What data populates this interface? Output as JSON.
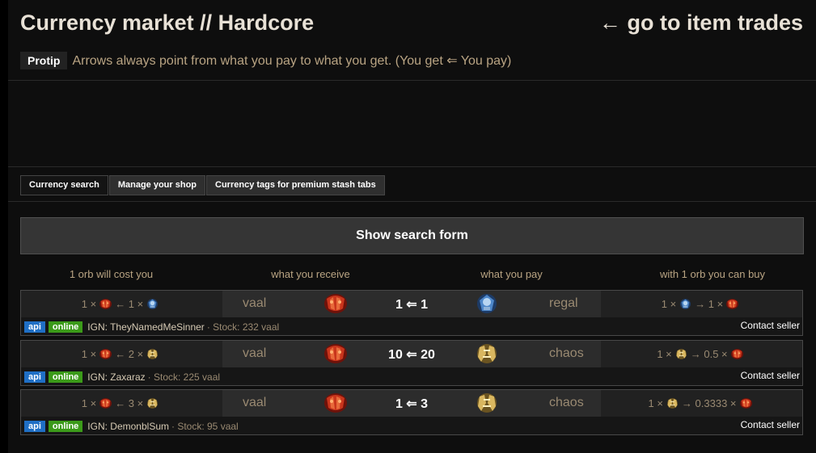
{
  "header": {
    "title": "Currency market // Hardcore",
    "goto_link": "← go to item trades"
  },
  "protip": {
    "label": "Protip",
    "text": "Arrows always point from what you pay to what you get. (You get ⇐ You pay)"
  },
  "tabs": [
    {
      "label": "Currency search"
    },
    {
      "label": "Manage your shop"
    },
    {
      "label": "Currency tags for premium stash tabs"
    }
  ],
  "show_form_label": "Show search form",
  "columns": {
    "cost": "1 orb will cost you",
    "receive": "what you receive",
    "pay": "what you pay",
    "buy": "with 1 orb you can buy"
  },
  "rows": [
    {
      "cost_left": "1 ×",
      "cost_mid": "← 1 ×",
      "receive": "vaal",
      "ratio": "1 ⇐ 1",
      "pay": "regal",
      "buy_left": "1 ×",
      "buy_mid": "→ 1 ×",
      "badge_api": "api",
      "badge_online": "online",
      "ign": "IGN: TheyNamedMeSinner",
      "stock": "· Stock: 232 vaal",
      "contact": "Contact seller",
      "pay_icon": "regal-orb-icon"
    },
    {
      "cost_left": "1 ×",
      "cost_mid": "← 2 ×",
      "receive": "vaal",
      "ratio": "10 ⇐ 20",
      "pay": "chaos",
      "buy_left": "1 ×",
      "buy_mid": "→ 0.5 ×",
      "badge_api": "api",
      "badge_online": "online",
      "ign": "IGN: Zaxaraz",
      "stock": "· Stock: 225 vaal",
      "contact": "Contact seller",
      "pay_icon": "chaos-orb-icon"
    },
    {
      "cost_left": "1 ×",
      "cost_mid": "← 3 ×",
      "receive": "vaal",
      "ratio": "1 ⇐ 3",
      "pay": "chaos",
      "buy_left": "1 ×",
      "buy_mid": "→ 0.3333 ×",
      "badge_api": "api",
      "badge_online": "online",
      "ign": "IGN: DemonblSum",
      "stock": "· Stock: 95 vaal",
      "contact": "Contact seller",
      "pay_icon": "chaos-orb-icon"
    }
  ],
  "colors": {
    "background": "#0e0e0e",
    "accent_text": "#b9a483",
    "api_badge": "#1f6fc5",
    "online_badge": "#3b9a19"
  }
}
